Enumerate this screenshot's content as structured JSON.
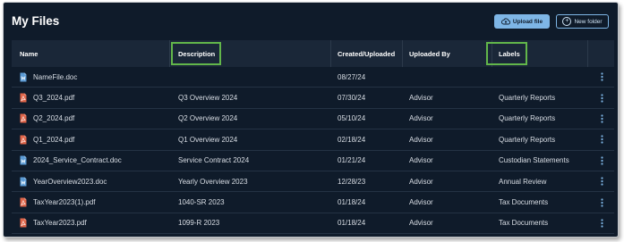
{
  "page": {
    "title": "My Files",
    "upload_label": "Upload file",
    "new_folder_label": "New folder"
  },
  "table": {
    "columns": {
      "name": "Name",
      "description": "Description",
      "created": "Created/Uploaded",
      "uploaded_by": "Uploaded By",
      "labels": "Labels"
    },
    "rows": [
      {
        "name": "NameFile.doc",
        "type": "doc",
        "description": "",
        "created": "08/27/24",
        "uploaded_by": "",
        "labels": ""
      },
      {
        "name": "Q3_2024.pdf",
        "type": "pdf",
        "description": "Q3 Overview 2024",
        "created": "07/30/24",
        "uploaded_by": "Advisor",
        "labels": "Quarterly Reports"
      },
      {
        "name": "Q2_2024.pdf",
        "type": "pdf",
        "description": "Q2 Overview 2024",
        "created": "05/10/24",
        "uploaded_by": "Advisor",
        "labels": "Quarterly Reports"
      },
      {
        "name": "Q1_2024.pdf",
        "type": "pdf",
        "description": "Q1 Overview 2024",
        "created": "02/18/24",
        "uploaded_by": "Advisor",
        "labels": "Quarterly Reports"
      },
      {
        "name": "2024_Service_Contract.doc",
        "type": "doc",
        "description": "Service Contract 2024",
        "created": "01/21/24",
        "uploaded_by": "Advisor",
        "labels": "Custodian Statements"
      },
      {
        "name": "YearOverview2023.doc",
        "type": "doc",
        "description": "Yearly Overview 2023",
        "created": "12/28/23",
        "uploaded_by": "Advisor",
        "labels": "Annual Review"
      },
      {
        "name": "TaxYear2023(1).pdf",
        "type": "pdf",
        "description": "1040-SR 2023",
        "created": "01/18/24",
        "uploaded_by": "Advisor",
        "labels": "Tax Documents"
      },
      {
        "name": "TaxYear2023.pdf",
        "type": "pdf",
        "description": "1099-R 2023",
        "created": "01/18/24",
        "uploaded_by": "Advisor",
        "labels": "Tax Documents"
      }
    ]
  },
  "colors": {
    "background": "#0f1b2a",
    "header_bg": "#1a2738",
    "accent": "#7eb6e6",
    "highlight": "#62b64a",
    "doc_icon": "#5b9bd5",
    "pdf_icon": "#e0664a"
  },
  "icons": {
    "upload": "cloud-upload-icon",
    "new_folder": "plus-circle-icon",
    "doc": "doc-file-icon",
    "pdf": "pdf-file-icon",
    "row_menu": "more-vertical-icon"
  }
}
